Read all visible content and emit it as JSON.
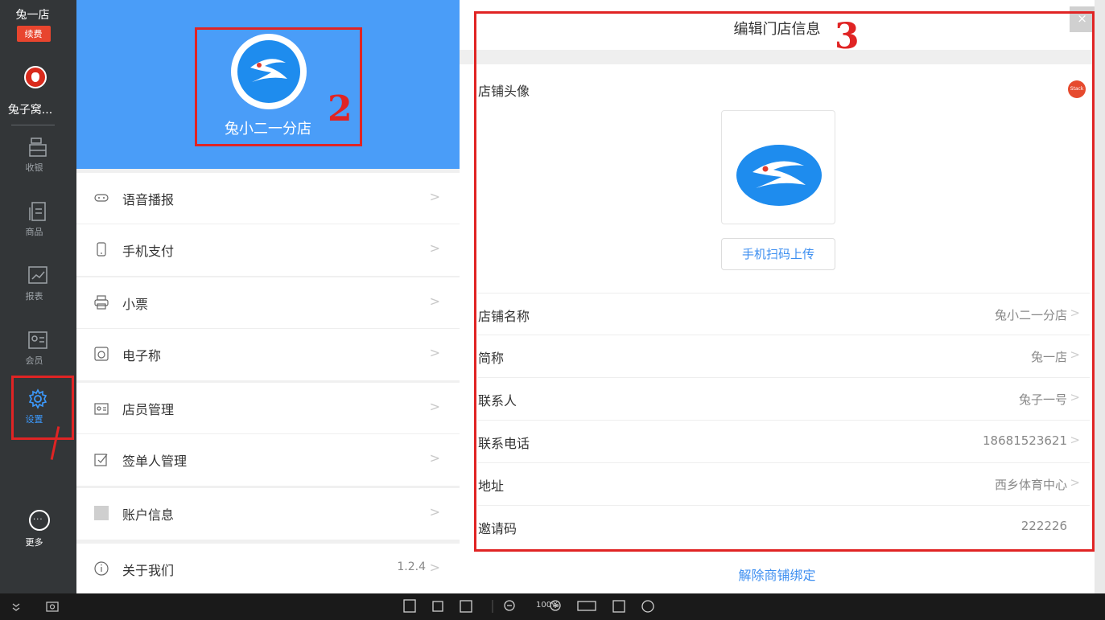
{
  "rail": {
    "store_name": "兔一店",
    "renew": "续费",
    "user_name": "兔子窝...",
    "items": [
      {
        "label": "收银"
      },
      {
        "label": "商品"
      },
      {
        "label": "报表"
      },
      {
        "label": "会员"
      },
      {
        "label": "设置"
      }
    ],
    "more": "更多",
    "more_glyph": "···"
  },
  "list": {
    "header_store": "兔小二一分店",
    "items": [
      {
        "label": "语音播报",
        "icon": "speaker-icon"
      },
      {
        "label": "手机支付",
        "icon": "phone-icon"
      },
      {
        "label": "小票",
        "icon": "printer-icon"
      },
      {
        "label": "电子称",
        "icon": "scale-icon"
      },
      {
        "label": "店员管理",
        "icon": "staff-icon"
      },
      {
        "label": "签单人管理",
        "icon": "sign-icon"
      },
      {
        "label": "账户信息",
        "icon": "account-icon"
      },
      {
        "label": "关于我们",
        "icon": "info-icon",
        "value": "1.2.4"
      }
    ],
    "chevron": ">"
  },
  "detail": {
    "title": "编辑门店信息",
    "close": "×",
    "avatar_label": "店铺头像",
    "stack_badge": "Stack",
    "upload_button": "手机扫码上传",
    "fields": [
      {
        "label": "店铺名称",
        "value": "兔小二一分店"
      },
      {
        "label": "简称",
        "value": "兔一店"
      },
      {
        "label": "联系人",
        "value": "兔子一号"
      },
      {
        "label": "联系电话",
        "value": "18681523621"
      },
      {
        "label": "地址",
        "value": "西乡体育中心"
      },
      {
        "label": "邀请码",
        "value": "222226"
      }
    ],
    "unbind_link": "解除商铺绑定"
  },
  "toolbar": {
    "zoom": "100%"
  },
  "annotations": {
    "mark_2": "2",
    "mark_3": "3"
  },
  "colors": {
    "accent": "#4a9df8",
    "rail_bg": "#333638",
    "annotation_red": "#e02424"
  }
}
